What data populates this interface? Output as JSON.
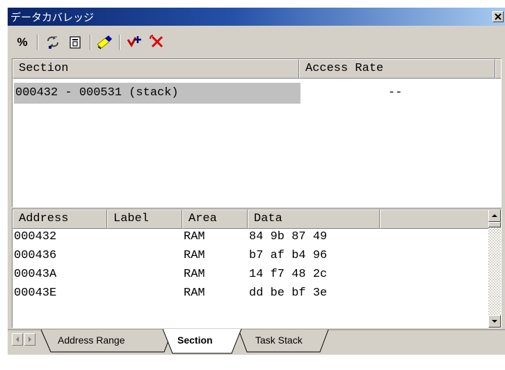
{
  "window": {
    "title": "データカバレッジ"
  },
  "toolbar": {
    "percent_label": "%"
  },
  "section_table": {
    "headers": [
      "Section",
      "Access Rate"
    ],
    "rows": [
      {
        "section": "000432 - 000531 (stack)",
        "access_rate": "--"
      }
    ]
  },
  "data_table": {
    "headers": [
      "Address",
      "Label",
      "Area",
      "Data"
    ],
    "rows": [
      {
        "address": "000432",
        "label": "",
        "area": "RAM",
        "data": "84 9b 87 49"
      },
      {
        "address": "000436",
        "label": "",
        "area": "RAM",
        "data": "b7 af b4 96"
      },
      {
        "address": "00043A",
        "label": "",
        "area": "RAM",
        "data": "14 f7 48 2c"
      },
      {
        "address": "00043E",
        "label": "",
        "area": "RAM",
        "data": "dd be bf 3e"
      }
    ]
  },
  "tabs": [
    {
      "label": "Address Range",
      "active": false
    },
    {
      "label": "Section",
      "active": true
    },
    {
      "label": "Task Stack",
      "active": false
    }
  ]
}
